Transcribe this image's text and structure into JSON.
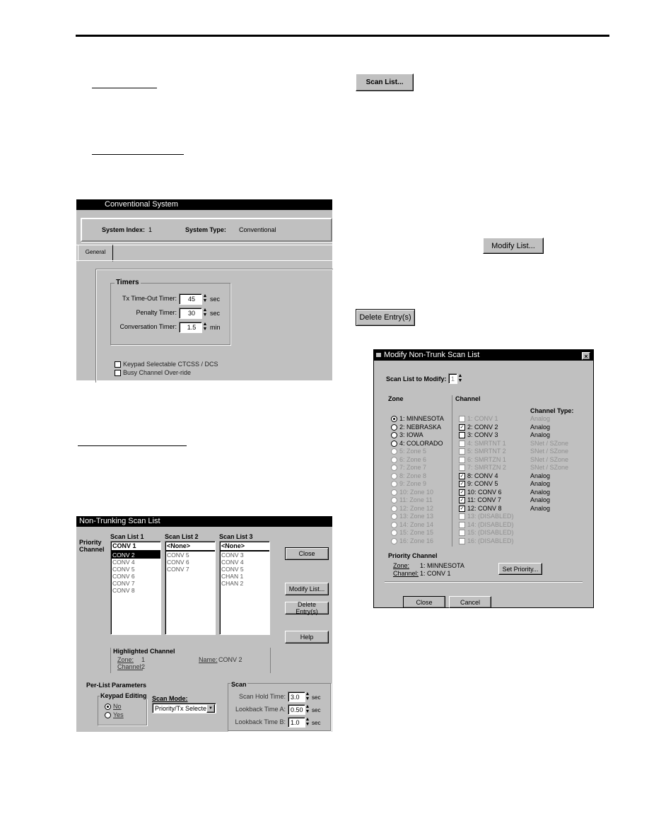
{
  "buttons": {
    "scan_list": "Scan List...",
    "modify_list": "Modify List...",
    "delete_entries": "Delete Entry(s)"
  },
  "conventional": {
    "title": "Conventional System",
    "system_index_label": "System Index:",
    "system_index": "1",
    "system_type_label": "System Type:",
    "system_type": "Conventional",
    "tab": "General",
    "timers_label": "Timers",
    "timers": [
      {
        "label": "Tx Time-Out Timer:",
        "value": "45",
        "unit": "sec"
      },
      {
        "label": "Penalty Timer:",
        "value": "30",
        "unit": "sec"
      },
      {
        "label": "Conversation Timer:",
        "value": "1.5",
        "unit": "min"
      }
    ],
    "checkboxes": [
      {
        "label": "Keypad Selectable CTCSS / DCS",
        "checked": false
      },
      {
        "label": "Busy Channel Over-ride",
        "checked": false
      }
    ]
  },
  "scan": {
    "title": "Non-Trunking Scan List",
    "priority_label": "Priority Channel",
    "lists": [
      {
        "header": "Scan List 1",
        "priority": "CONV 1",
        "items": [
          "CONV 2",
          "CONV 4",
          "CONV 5",
          "CONV 6",
          "CONV 7",
          "CONV 8"
        ],
        "selected": 0
      },
      {
        "header": "Scan List 2",
        "priority": "<None>",
        "items": [
          "CONV 5",
          "CONV 6",
          "CONV 7"
        ],
        "selected": -1
      },
      {
        "header": "Scan List 3",
        "priority": "<None>",
        "items": [
          "CONV 3",
          "CONV 4",
          "CONV 5",
          "CHAN 1",
          "CHAN 2"
        ],
        "selected": -1
      }
    ],
    "close": "Close",
    "modify": "Modify List...",
    "delete": "Delete Entry(s)",
    "help": "Help",
    "highlighted": {
      "title": "Highlighted Channel",
      "zone_label": "Zone:",
      "zone": "1",
      "channel_label": "Channel:",
      "channel": "2",
      "name_label": "Name:",
      "name": "CONV 2"
    },
    "per_list": "Per-List Parameters",
    "keypad_label": "Keypad Editing",
    "keypad_options": [
      {
        "label": "No",
        "checked": true
      },
      {
        "label": "Yes",
        "checked": false
      }
    ],
    "scan_mode_label": "Scan Mode:",
    "scan_mode": "Priority/Tx Selected",
    "scan_group": "Scan",
    "scan_params": [
      {
        "label": "Scan Hold Time:",
        "value": "3.0",
        "unit": "sec"
      },
      {
        "label": "Lookback Time A:",
        "value": "0.50",
        "unit": "sec"
      },
      {
        "label": "Lookback Time B:",
        "value": "1.0",
        "unit": "sec"
      }
    ]
  },
  "modify": {
    "title": "Modify Non-Trunk Scan List",
    "close_x": "×",
    "list_label": "Scan List to Modify:",
    "list_value": "1",
    "zone_header": "Zone",
    "channel_header": "Channel",
    "type_header": "Channel Type:",
    "zones": [
      {
        "label": "1: MINNESOTA",
        "on": true,
        "enabled": true
      },
      {
        "label": "2: NEBRASKA",
        "on": false,
        "enabled": true
      },
      {
        "label": "3: IOWA",
        "on": false,
        "enabled": true
      },
      {
        "label": "4: COLORADO",
        "on": false,
        "enabled": true
      },
      {
        "label": "5: Zone 5",
        "on": false,
        "enabled": false
      },
      {
        "label": "6: Zone 6",
        "on": false,
        "enabled": false
      },
      {
        "label": "7: Zone 7",
        "on": false,
        "enabled": false
      },
      {
        "label": "8: Zone 8",
        "on": false,
        "enabled": false
      },
      {
        "label": "9: Zone 9",
        "on": false,
        "enabled": false
      },
      {
        "label": "10: Zone 10",
        "on": false,
        "enabled": false
      },
      {
        "label": "11: Zone 11",
        "on": false,
        "enabled": false
      },
      {
        "label": "12: Zone 12",
        "on": false,
        "enabled": false
      },
      {
        "label": "13: Zone 13",
        "on": false,
        "enabled": false
      },
      {
        "label": "14: Zone 14",
        "on": false,
        "enabled": false
      },
      {
        "label": "15: Zone 15",
        "on": false,
        "enabled": false
      },
      {
        "label": "16: Zone 16",
        "on": false,
        "enabled": false
      }
    ],
    "channels": [
      {
        "label": "1: CONV 1",
        "type": "Analog",
        "checked": false,
        "enabled": false
      },
      {
        "label": "2: CONV 2",
        "type": "Analog",
        "checked": true,
        "enabled": true
      },
      {
        "label": "3: CONV 3",
        "type": "Analog",
        "checked": false,
        "enabled": true
      },
      {
        "label": "4: SMRTNT 1",
        "type": "SNet / SZone",
        "checked": false,
        "enabled": false
      },
      {
        "label": "5: SMRTNT 2",
        "type": "SNet / SZone",
        "checked": false,
        "enabled": false
      },
      {
        "label": "6: SMRTZN 1",
        "type": "SNet / SZone",
        "checked": false,
        "enabled": false
      },
      {
        "label": "7: SMRTZN 2",
        "type": "SNet / SZone",
        "checked": false,
        "enabled": false
      },
      {
        "label": "8: CONV 4",
        "type": "Analog",
        "checked": true,
        "enabled": true
      },
      {
        "label": "9: CONV 5",
        "type": "Analog",
        "checked": true,
        "enabled": true
      },
      {
        "label": "10: CONV 6",
        "type": "Analog",
        "checked": true,
        "enabled": true
      },
      {
        "label": "11: CONV 7",
        "type": "Analog",
        "checked": true,
        "enabled": true
      },
      {
        "label": "12: CONV 8",
        "type": "Analog",
        "checked": true,
        "enabled": true
      },
      {
        "label": "13: (DISABLED)",
        "type": "",
        "checked": false,
        "enabled": false
      },
      {
        "label": "14: (DISABLED)",
        "type": "",
        "checked": false,
        "enabled": false
      },
      {
        "label": "15: (DISABLED)",
        "type": "",
        "checked": false,
        "enabled": false
      },
      {
        "label": "16: (DISABLED)",
        "type": "",
        "checked": false,
        "enabled": false
      }
    ],
    "priority_title": "Priority Channel",
    "zone_label": "Zone:",
    "zone_value": "1: MINNESOTA",
    "channel_label": "Channel:",
    "channel_value": "1: CONV 1",
    "set_priority": "Set Priority...",
    "close": "Close",
    "cancel": "Cancel"
  }
}
